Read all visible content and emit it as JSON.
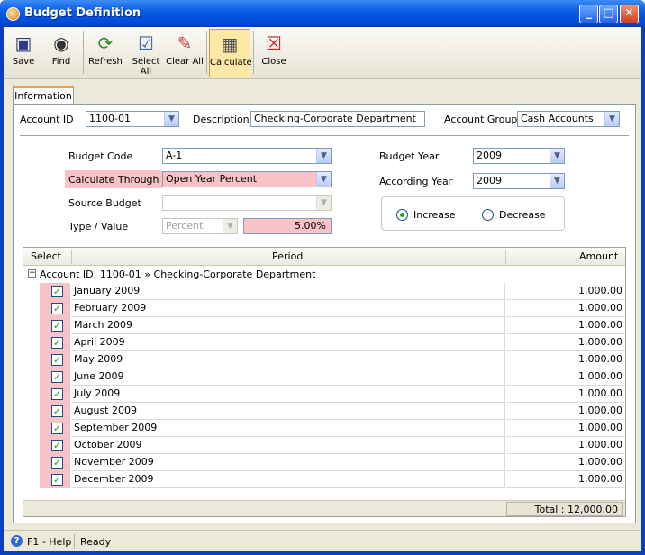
{
  "window": {
    "title": "Budget Definition"
  },
  "toolbar": {
    "save": "Save",
    "find": "Find",
    "refresh": "Refresh",
    "select_all": "Select All",
    "clear_all": "Clear All",
    "calculate": "Calculate",
    "close": "Close"
  },
  "tab": {
    "label": "Information"
  },
  "header": {
    "account_id_label": "Account ID",
    "account_id": "1100-01",
    "description_label": "Description",
    "description": "Checking-Corporate Department",
    "account_group_label": "Account Group",
    "account_group": "Cash Accounts"
  },
  "form": {
    "budget_code_label": "Budget Code",
    "budget_code": "A-1",
    "calc_through_label": "Calculate Through",
    "calc_through": "Open Year Percent",
    "source_budget_label": "Source Budget",
    "source_budget": "",
    "type_value_label": "Type / Value",
    "type": "Percent",
    "value": "5.00%",
    "budget_year_label": "Budget Year",
    "budget_year": "2009",
    "according_year_label": "According Year",
    "according_year": "2009",
    "increase_label": "Increase",
    "decrease_label": "Decrease",
    "selected": "Increase"
  },
  "grid": {
    "columns": [
      "Select",
      "Period",
      "Amount"
    ],
    "group": "Account ID: 1100-01 » Checking-Corporate Department",
    "rows": [
      {
        "period": "January 2009",
        "amount": "1,000.00"
      },
      {
        "period": "February 2009",
        "amount": "1,000.00"
      },
      {
        "period": "March 2009",
        "amount": "1,000.00"
      },
      {
        "period": "April 2009",
        "amount": "1,000.00"
      },
      {
        "period": "May 2009",
        "amount": "1,000.00"
      },
      {
        "period": "June 2009",
        "amount": "1,000.00"
      },
      {
        "period": "July 2009",
        "amount": "1,000.00"
      },
      {
        "period": "August 2009",
        "amount": "1,000.00"
      },
      {
        "period": "September 2009",
        "amount": "1,000.00"
      },
      {
        "period": "October 2009",
        "amount": "1,000.00"
      },
      {
        "period": "November 2009",
        "amount": "1,000.00"
      },
      {
        "period": "December 2009",
        "amount": "1,000.00"
      }
    ],
    "total": "Total : 12,000.00"
  },
  "status": {
    "help": "F1 - Help",
    "state": "Ready"
  },
  "colors": {
    "highlight": "#f9c2c6",
    "title_bar": "#0a5ce6",
    "active_tool": "#fde8a6"
  }
}
